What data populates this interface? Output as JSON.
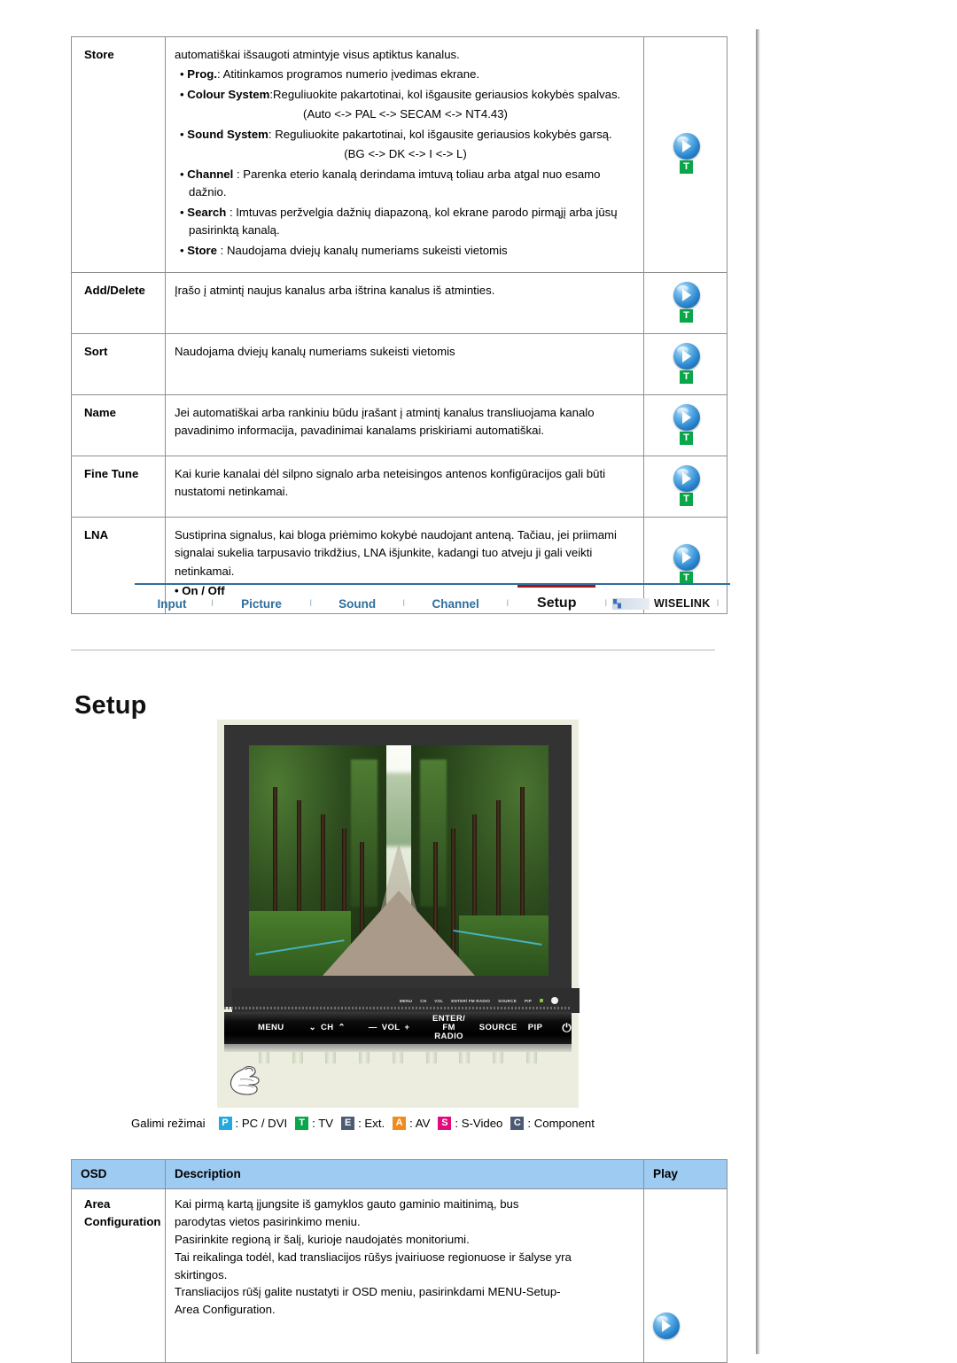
{
  "feature_table": {
    "rows": [
      {
        "name": "Store",
        "lines": [
          {
            "type": "plain",
            "text": "automatiškai išsaugoti atmintyje visus aptiktus kanalus."
          },
          {
            "type": "bullet",
            "bold": "Prog.",
            "rest": ": Atitinkamos programos numerio įvedimas ekrane."
          },
          {
            "type": "bullet",
            "bold": "Colour System",
            "rest": ":Reguliuokite pakartotinai, kol išgausite geriausios kokybės spalvas."
          },
          {
            "type": "center",
            "text": "(Auto <-> PAL <-> SECAM <-> NT4.43)"
          },
          {
            "type": "bullet",
            "bold": "Sound System",
            "rest": ": Reguliuokite pakartotinai, kol išgausite geriausios kokybės garsą."
          },
          {
            "type": "center",
            "text": "(BG <-> DK <-> I <-> L)"
          },
          {
            "type": "bullet",
            "bold": "Channel",
            "rest": " : Parenka eterio kanalą derindama imtuvą toliau arba atgal nuo esamo dažnio."
          },
          {
            "type": "bullet",
            "bold": "Search",
            "rest": " : Imtuvas peržvelgia dažnių diapazoną, kol ekrane parodo pirmąjį arba jūsų pasirinktą kanalą."
          },
          {
            "type": "bullet",
            "bold": "Store",
            "rest": " : Naudojama dviejų kanalų numeriams sukeisti vietomis"
          }
        ],
        "icons": [
          "play",
          "tv"
        ]
      },
      {
        "name": "Add/Delete",
        "lines": [
          {
            "type": "plain",
            "text": "Įrašo į atmintį naujus kanalus arba ištrina kanalus iš atminties."
          }
        ],
        "icons": [
          "play",
          "tv"
        ]
      },
      {
        "name": "Sort",
        "lines": [
          {
            "type": "plain",
            "text": "Naudojama dviejų kanalų numeriams sukeisti vietomis"
          }
        ],
        "icons": [
          "play",
          "tv"
        ]
      },
      {
        "name": "Name",
        "lines": [
          {
            "type": "plain",
            "text": "Jei automatiškai arba rankiniu būdu įrašant į atmintį kanalus transliuojama kanalo pavadinimo informacija, pavadinimai kanalams priskiriami automatiškai."
          }
        ],
        "icons": [
          "play",
          "tv"
        ]
      },
      {
        "name": "Fine Tune",
        "lines": [
          {
            "type": "plain",
            "text": "Kai kurie kanalai dėl silpno signalo arba neteisingos antenos konfigūracijos gali būti nustatomi netinkamai."
          }
        ],
        "icons": [
          "play",
          "tv"
        ]
      },
      {
        "name": "LNA",
        "lines": [
          {
            "type": "plain",
            "text": "Sustiprina signalus, kai bloga priėmimo kokybė naudojant anteną. Tačiau, jei priimami signalai sukelia tarpusavio trikdžius, LNA išjunkite, kadangi tuo atveju ji gali veikti netinkamai."
          },
          {
            "type": "bullet-bold",
            "text": "On / Off"
          }
        ],
        "icons": [
          "play",
          "tv"
        ]
      }
    ]
  },
  "navbar": {
    "tabs": [
      {
        "label": "Input",
        "active": false
      },
      {
        "label": "Picture",
        "active": false
      },
      {
        "label": "Sound",
        "active": false
      },
      {
        "label": "Channel",
        "active": false
      },
      {
        "label": "Setup",
        "active": true
      }
    ],
    "separator": "I",
    "wiselink_label": "WISELINK",
    "wiselink_logo_text": "WISELINK",
    "active_underline_color": "#a11717",
    "tab_color": "#2e6f9e"
  },
  "page": {
    "heading": "Setup"
  },
  "monitor": {
    "osd_mini_buttons": [
      "MENU",
      "CH",
      "VOL",
      "ENTER/ FM RADIO",
      "SOURCE",
      "PIP"
    ],
    "controls": [
      {
        "label": "MENU",
        "glyph": ""
      },
      {
        "label": "CH",
        "glyph_left": "⌄",
        "glyph_right": "⌃"
      },
      {
        "label": "VOL",
        "glyph_left": "—",
        "glyph_right": "+"
      },
      {
        "label": "ENTER/",
        "label2": "FM RADIO"
      },
      {
        "label": "SOURCE"
      },
      {
        "label": "PIP"
      },
      {
        "label": "⏻"
      }
    ]
  },
  "legend": {
    "label": "Galimi režimai",
    "items": [
      {
        "badge": "P",
        "cls": "pc",
        "text": ": PC / DVI"
      },
      {
        "badge": "T",
        "cls": "tv",
        "text": ": TV"
      },
      {
        "badge": "E",
        "cls": "ext",
        "text": ": Ext."
      },
      {
        "badge": "A",
        "cls": "av",
        "text": ": AV"
      },
      {
        "badge": "S",
        "cls": "sv",
        "text": ": S-Video"
      },
      {
        "badge": "C",
        "cls": "comp",
        "text": ": Component"
      }
    ]
  },
  "osd_table": {
    "headers": [
      "OSD",
      "Description",
      "Play"
    ],
    "header_bg": "#9ecbf2",
    "rows": [
      {
        "name_line1": "Area",
        "name_line2": "Configuration",
        "lines": [
          "Kai pirmą kartą įjungsite iš gamyklos gauto gaminio maitinimą, bus",
          "parodytas vietos pasirinkimo meniu.",
          "Pasirinkite regioną ir šalį, kurioje naudojatės monitoriumi.",
          "Tai reikalinga todėl, kad transliacijos rūšys įvairiuose regionuose ir šalyse yra",
          "skirtingos.",
          "Transliacijos rūšį galite nustatyti ir OSD meniu, pasirinkdami MENU-Setup-",
          "Area Configuration."
        ],
        "icons": [
          "play"
        ]
      }
    ]
  }
}
